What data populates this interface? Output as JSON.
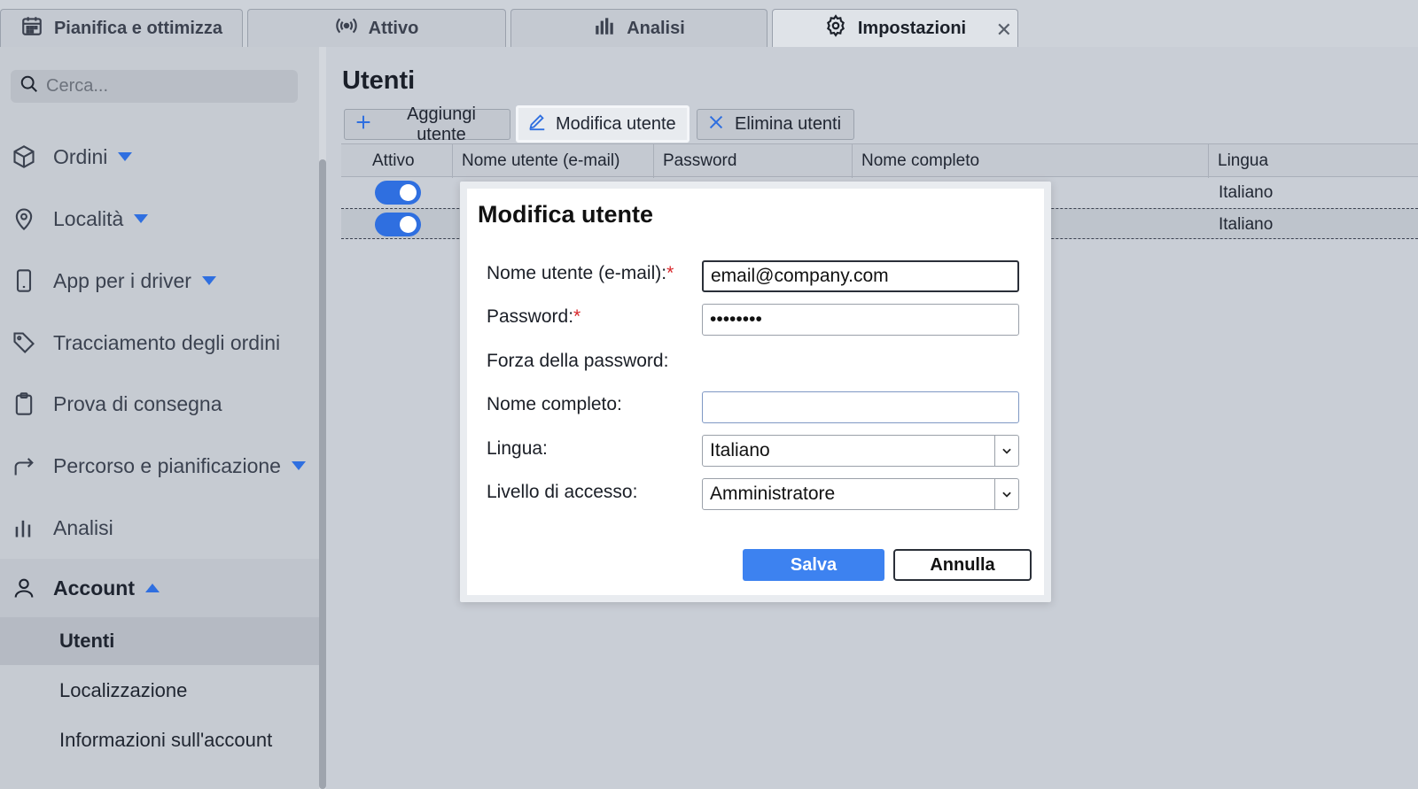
{
  "tabs": [
    {
      "label": "Pianifica e ottimizza",
      "icon": "calendar-icon"
    },
    {
      "label": "Attivo",
      "icon": "broadcast-icon"
    },
    {
      "label": "Analisi",
      "icon": "bar-chart-icon"
    },
    {
      "label": "Impostazioni",
      "icon": "gear-icon",
      "active": true,
      "close": "✕"
    }
  ],
  "sidebar": {
    "search_placeholder": "Cerca...",
    "items": [
      {
        "label": "Ordini",
        "icon": "box-icon"
      },
      {
        "label": "Località",
        "icon": "map-pin-icon"
      },
      {
        "label": "App per i driver",
        "icon": "phone-icon"
      },
      {
        "label": "Tracciamento degli ordini",
        "icon": "tag-icon"
      },
      {
        "label": "Prova di consegna",
        "icon": "clipboard-icon"
      },
      {
        "label": "Percorso e pianificazione",
        "icon": "route-arrow-icon"
      },
      {
        "label": "Analisi",
        "icon": "bar-chart-icon"
      },
      {
        "label": "Account",
        "icon": "user-icon"
      }
    ],
    "sub_items": [
      {
        "label": "Utenti",
        "active": true
      },
      {
        "label": "Localizzazione"
      },
      {
        "label": "Informazioni sull'account"
      }
    ]
  },
  "main": {
    "title": "Utenti",
    "toolbar": {
      "add": "Aggiungi utente",
      "edit": "Modifica utente",
      "delete": "Elimina utenti"
    },
    "columns": [
      "Attivo",
      "Nome utente (e-mail)",
      "Password",
      "Nome completo",
      "Lingua"
    ],
    "rows": [
      {
        "active": true,
        "language": "Italiano"
      },
      {
        "active": true,
        "language": "Italiano"
      }
    ]
  },
  "modal": {
    "title": "Modifica utente",
    "username_label": "Nome utente (e-mail):",
    "username_value": "email@company.com",
    "password_label": "Password:",
    "password_value": "password",
    "strength_label": "Forza della password:",
    "fullname_label": "Nome completo:",
    "fullname_value": "",
    "language_label": "Lingua:",
    "language_value": "Italiano",
    "access_label": "Livello di accesso:",
    "access_value": "Amministratore",
    "required_mark": "*",
    "save": "Salva",
    "cancel": "Annulla"
  },
  "colors": {
    "accent": "#3d82f0",
    "toggle": "#2f6fe0",
    "required": "#d8262a"
  }
}
